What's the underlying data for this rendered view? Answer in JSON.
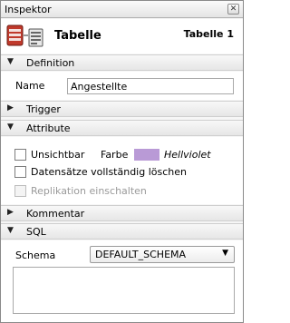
{
  "window": {
    "title": "Inspektor",
    "close_glyph": "✕"
  },
  "header": {
    "icon": "table-icon",
    "title": "Tabelle",
    "name": "Tabelle 1"
  },
  "sections": {
    "definition": {
      "label": "Definition",
      "expanded": true
    },
    "trigger": {
      "label": "Trigger",
      "expanded": false
    },
    "attribute": {
      "label": "Attribute",
      "expanded": true
    },
    "kommentar": {
      "label": "Kommentar",
      "expanded": false
    },
    "sql": {
      "label": "SQL",
      "expanded": true
    }
  },
  "definition": {
    "name_label": "Name",
    "name_value": "Angestellte"
  },
  "attribute": {
    "unsichtbar_label": "Unsichtbar",
    "unsichtbar_checked": false,
    "farbe_label": "Farbe",
    "farbe_color": "#b99ad6",
    "farbe_name": "Hellviolet",
    "datensaetze_label": "Datensätze vollständig löschen",
    "datensaetze_checked": false,
    "replikation_label": "Replikation einschalten",
    "replikation_checked": false,
    "replikation_enabled": false
  },
  "sql": {
    "schema_label": "Schema",
    "schema_value": "DEFAULT_SCHEMA",
    "sql_text": ""
  },
  "icons": {
    "expanded": "▼",
    "collapsed": "▶",
    "dropdown": "▼"
  }
}
